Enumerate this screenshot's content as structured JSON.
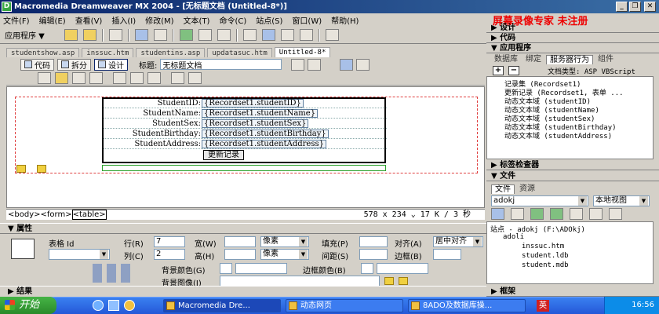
{
  "window": {
    "title": "Macromedia Dreamweaver MX 2004 - [无标题文档 (Untitled-8*)]",
    "minimize": "_",
    "maximize": "❐",
    "close": "✕"
  },
  "menu": [
    "文件(F)",
    "编辑(E)",
    "查看(V)",
    "插入(I)",
    "修改(M)",
    "文本(T)",
    "命令(C)",
    "站点(S)",
    "窗口(W)",
    "帮助(H)"
  ],
  "watermark": "屏幕录像专家 未注册",
  "insertbar": {
    "category": "应用程序 ▼"
  },
  "doc_tabs": [
    {
      "label": "studentshow.asp",
      "active": false
    },
    {
      "label": "inssuc.htm",
      "active": false
    },
    {
      "label": "studentins.asp",
      "active": false
    },
    {
      "label": "updatasuc.htm",
      "active": false
    },
    {
      "label": "Untitled-8*",
      "active": true
    }
  ],
  "doc_toolbar": {
    "code": "代码",
    "split": "拆分",
    "design": "设计",
    "title_label": "标题:",
    "title_value": "无标题文档"
  },
  "form_rows": [
    {
      "label": "StudentID:",
      "field": "{Recordset1.studentID}"
    },
    {
      "label": "StudentName:",
      "field": "{Recordset1.studentName}"
    },
    {
      "label": "StudentSex:",
      "field": "{Recordset1.studentSex}"
    },
    {
      "label": "StudentBirthday:",
      "field": "{Recordset1.studentBirthday}"
    },
    {
      "label": "StudentAddress:",
      "field": "{Recordset1.studentAddress}"
    }
  ],
  "submit_button": "更新记录",
  "statusbar": {
    "tags": [
      "<body>",
      "<form>",
      "<table>"
    ],
    "info": "578 x 234 ⌄ 17 K / 3 秒"
  },
  "properties": {
    "header": "▼ 属性",
    "table_id_label": "表格 Id",
    "rows_label": "行(R)",
    "rows_value": "7",
    "cols_label": "列(C)",
    "cols_value": "2",
    "width_label": "宽(W)",
    "height_label": "高(H)",
    "width_unit": "像素",
    "height_unit": "像素",
    "padding_label": "填充(P)",
    "spacing_label": "间距(S)",
    "align_label": "对齐(A)",
    "align_value": "居中对齐",
    "border_label": "边框(B)",
    "bgcolor_label": "背景颜色(G)",
    "bordercolor_label": "边框颜色(B)",
    "bgimage_label": "背景图像(I)"
  },
  "results_bar": "▶ 结果",
  "right_panel": {
    "design": "▶ 设计",
    "code": "▶ 代码",
    "application": "▼ 应用程序",
    "app_tabs": [
      {
        "label": "数据库",
        "active": false
      },
      {
        "label": "绑定",
        "active": false
      },
      {
        "label": "服务器行为",
        "active": true
      },
      {
        "label": "组件",
        "active": false
      }
    ],
    "doc_type": "文档类型: ASP VBScript",
    "server_behaviors": [
      "记录集 (Recordset1)",
      "更新记录 (Recordset1, 表单 ...",
      "动态文本域 (studentID)",
      "动态文本域 (studentName)",
      "动态文本域 (studentSex)",
      "动态文本域 (studentBirthday)",
      "动态文本域 (studentAddress)"
    ],
    "tag_inspector": "▶ 标签检查器",
    "files": "▼ 文件",
    "file_tabs": [
      {
        "label": "文件",
        "active": true
      },
      {
        "label": "资源",
        "active": false
      }
    ],
    "site": "adokj",
    "view": "本地视图",
    "tree": [
      {
        "label": "站点 - adokj (F:\\ADOkj)",
        "level": 0
      },
      {
        "label": "adoli",
        "level": 1
      },
      {
        "label": "inssuc.htm",
        "level": 2
      },
      {
        "label": "student.ldb",
        "level": 2
      },
      {
        "label": "student.mdb",
        "level": 2
      }
    ],
    "frames": "▶ 框架"
  },
  "taskbar": {
    "start": "开始",
    "tasks": [
      {
        "label": "Macromedia Dre...",
        "active": true
      },
      {
        "label": "动态网页",
        "active": false
      },
      {
        "label": "8ADO及数据库操...",
        "active": false
      }
    ],
    "ime": "英",
    "clock": "16:56"
  }
}
